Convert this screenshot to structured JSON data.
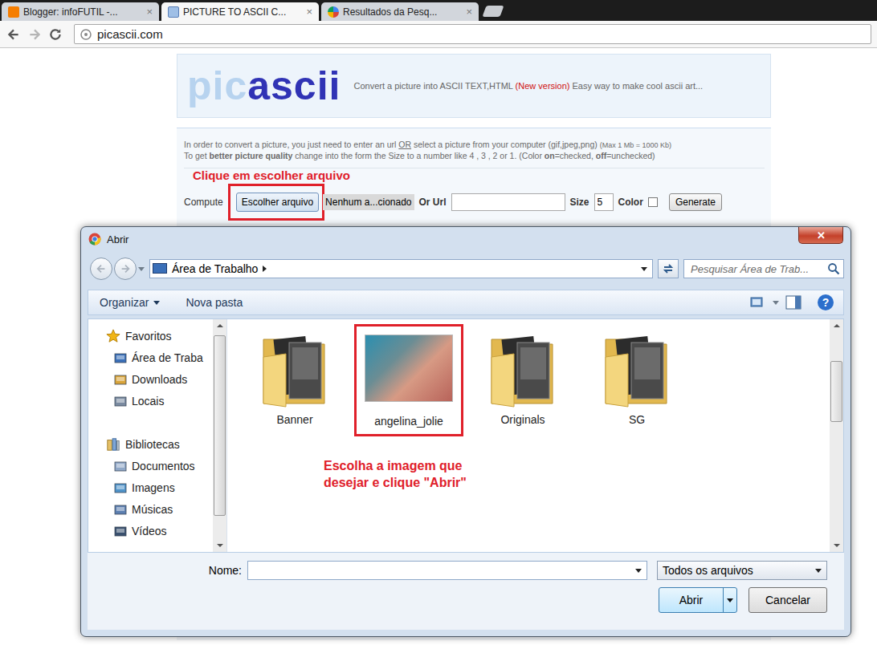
{
  "browser": {
    "tabs": [
      {
        "label": "Blogger: infoFUTIL -...",
        "selected": false,
        "close": "×"
      },
      {
        "label": "PICTURE TO ASCII C...",
        "selected": true,
        "close": "×"
      },
      {
        "label": "Resultados da Pesq...",
        "selected": false,
        "close": "×"
      }
    ],
    "address": "picascii.com"
  },
  "page": {
    "logo": {
      "light": "pic",
      "dark": "ascii"
    },
    "tagline": [
      {
        "text": "Convert a picture into ASCII TEXT,HTML ",
        "kind": "plain"
      },
      {
        "text": "(New version)",
        "kind": "alert"
      },
      {
        "text": " Easy way to make cool ascii art...",
        "kind": "plain"
      }
    ],
    "instructions": [
      [
        {
          "text": "In order to convert a picture, you just need to enter an url ",
          "kind": "plain"
        },
        {
          "text": "OR",
          "kind": "underline"
        },
        {
          "text": " select a picture from your computer (gif,jpeg,png) ",
          "kind": "plain"
        },
        {
          "text": "(Max 1 Mb = 1000 Kb)",
          "kind": "small"
        }
      ],
      [
        {
          "text": "To get ",
          "kind": "plain"
        },
        {
          "text": "better picture quality",
          "kind": "bold"
        },
        {
          "text": " change into the form the Size to a number like 4 , 3 , 2 or 1. (Color ",
          "kind": "plain"
        },
        {
          "text": "on",
          "kind": "bold"
        },
        {
          "text": "=checked, ",
          "kind": "plain"
        },
        {
          "text": "off",
          "kind": "bold"
        },
        {
          "text": "=unchecked)",
          "kind": "plain"
        }
      ]
    ],
    "form": {
      "label": "Compute",
      "file_button": "Escolher arquivo",
      "file_status": "Nenhum a...cionado",
      "url_label": "Or Url",
      "url_value": "",
      "size_label": "Size",
      "size_value": "5",
      "color_label": "Color",
      "color_checked": false,
      "submit": "Generate"
    }
  },
  "annotations": {
    "choose_file": "Clique em escolher arquivo",
    "pick_image": "Escolha a imagem que desejar e clique \"Abrir\""
  },
  "dialog": {
    "title": "Abrir",
    "close": "✕",
    "path": "Área de Trabalho",
    "search_placeholder": "Pesquisar Área de Trab...",
    "toolbar": {
      "organize": "Organizar",
      "new_folder": "Nova pasta",
      "help": "?"
    },
    "sidebar": [
      {
        "group": "Favoritos",
        "kind": "favorites",
        "items": [
          {
            "label": "Área de Traba",
            "kind": "desktop"
          },
          {
            "label": "Downloads",
            "kind": "downloads"
          },
          {
            "label": "Locais",
            "kind": "places"
          }
        ]
      },
      {
        "group": "Bibliotecas",
        "kind": "libraries",
        "items": [
          {
            "label": "Documentos",
            "kind": "documents"
          },
          {
            "label": "Imagens",
            "kind": "images"
          },
          {
            "label": "Músicas",
            "kind": "music"
          },
          {
            "label": "Vídeos",
            "kind": "videos"
          }
        ]
      }
    ],
    "files": [
      {
        "name": "Banner",
        "kind": "folder",
        "selected": false
      },
      {
        "name": "angelina_jolie",
        "kind": "image",
        "selected": true
      },
      {
        "name": "Originals",
        "kind": "folder",
        "selected": false
      },
      {
        "name": "SG",
        "kind": "folder",
        "selected": false
      }
    ],
    "name_label": "Nome:",
    "name_value": "",
    "filter": "Todos os arquivos",
    "open": "Abrir",
    "cancel": "Cancelar"
  }
}
